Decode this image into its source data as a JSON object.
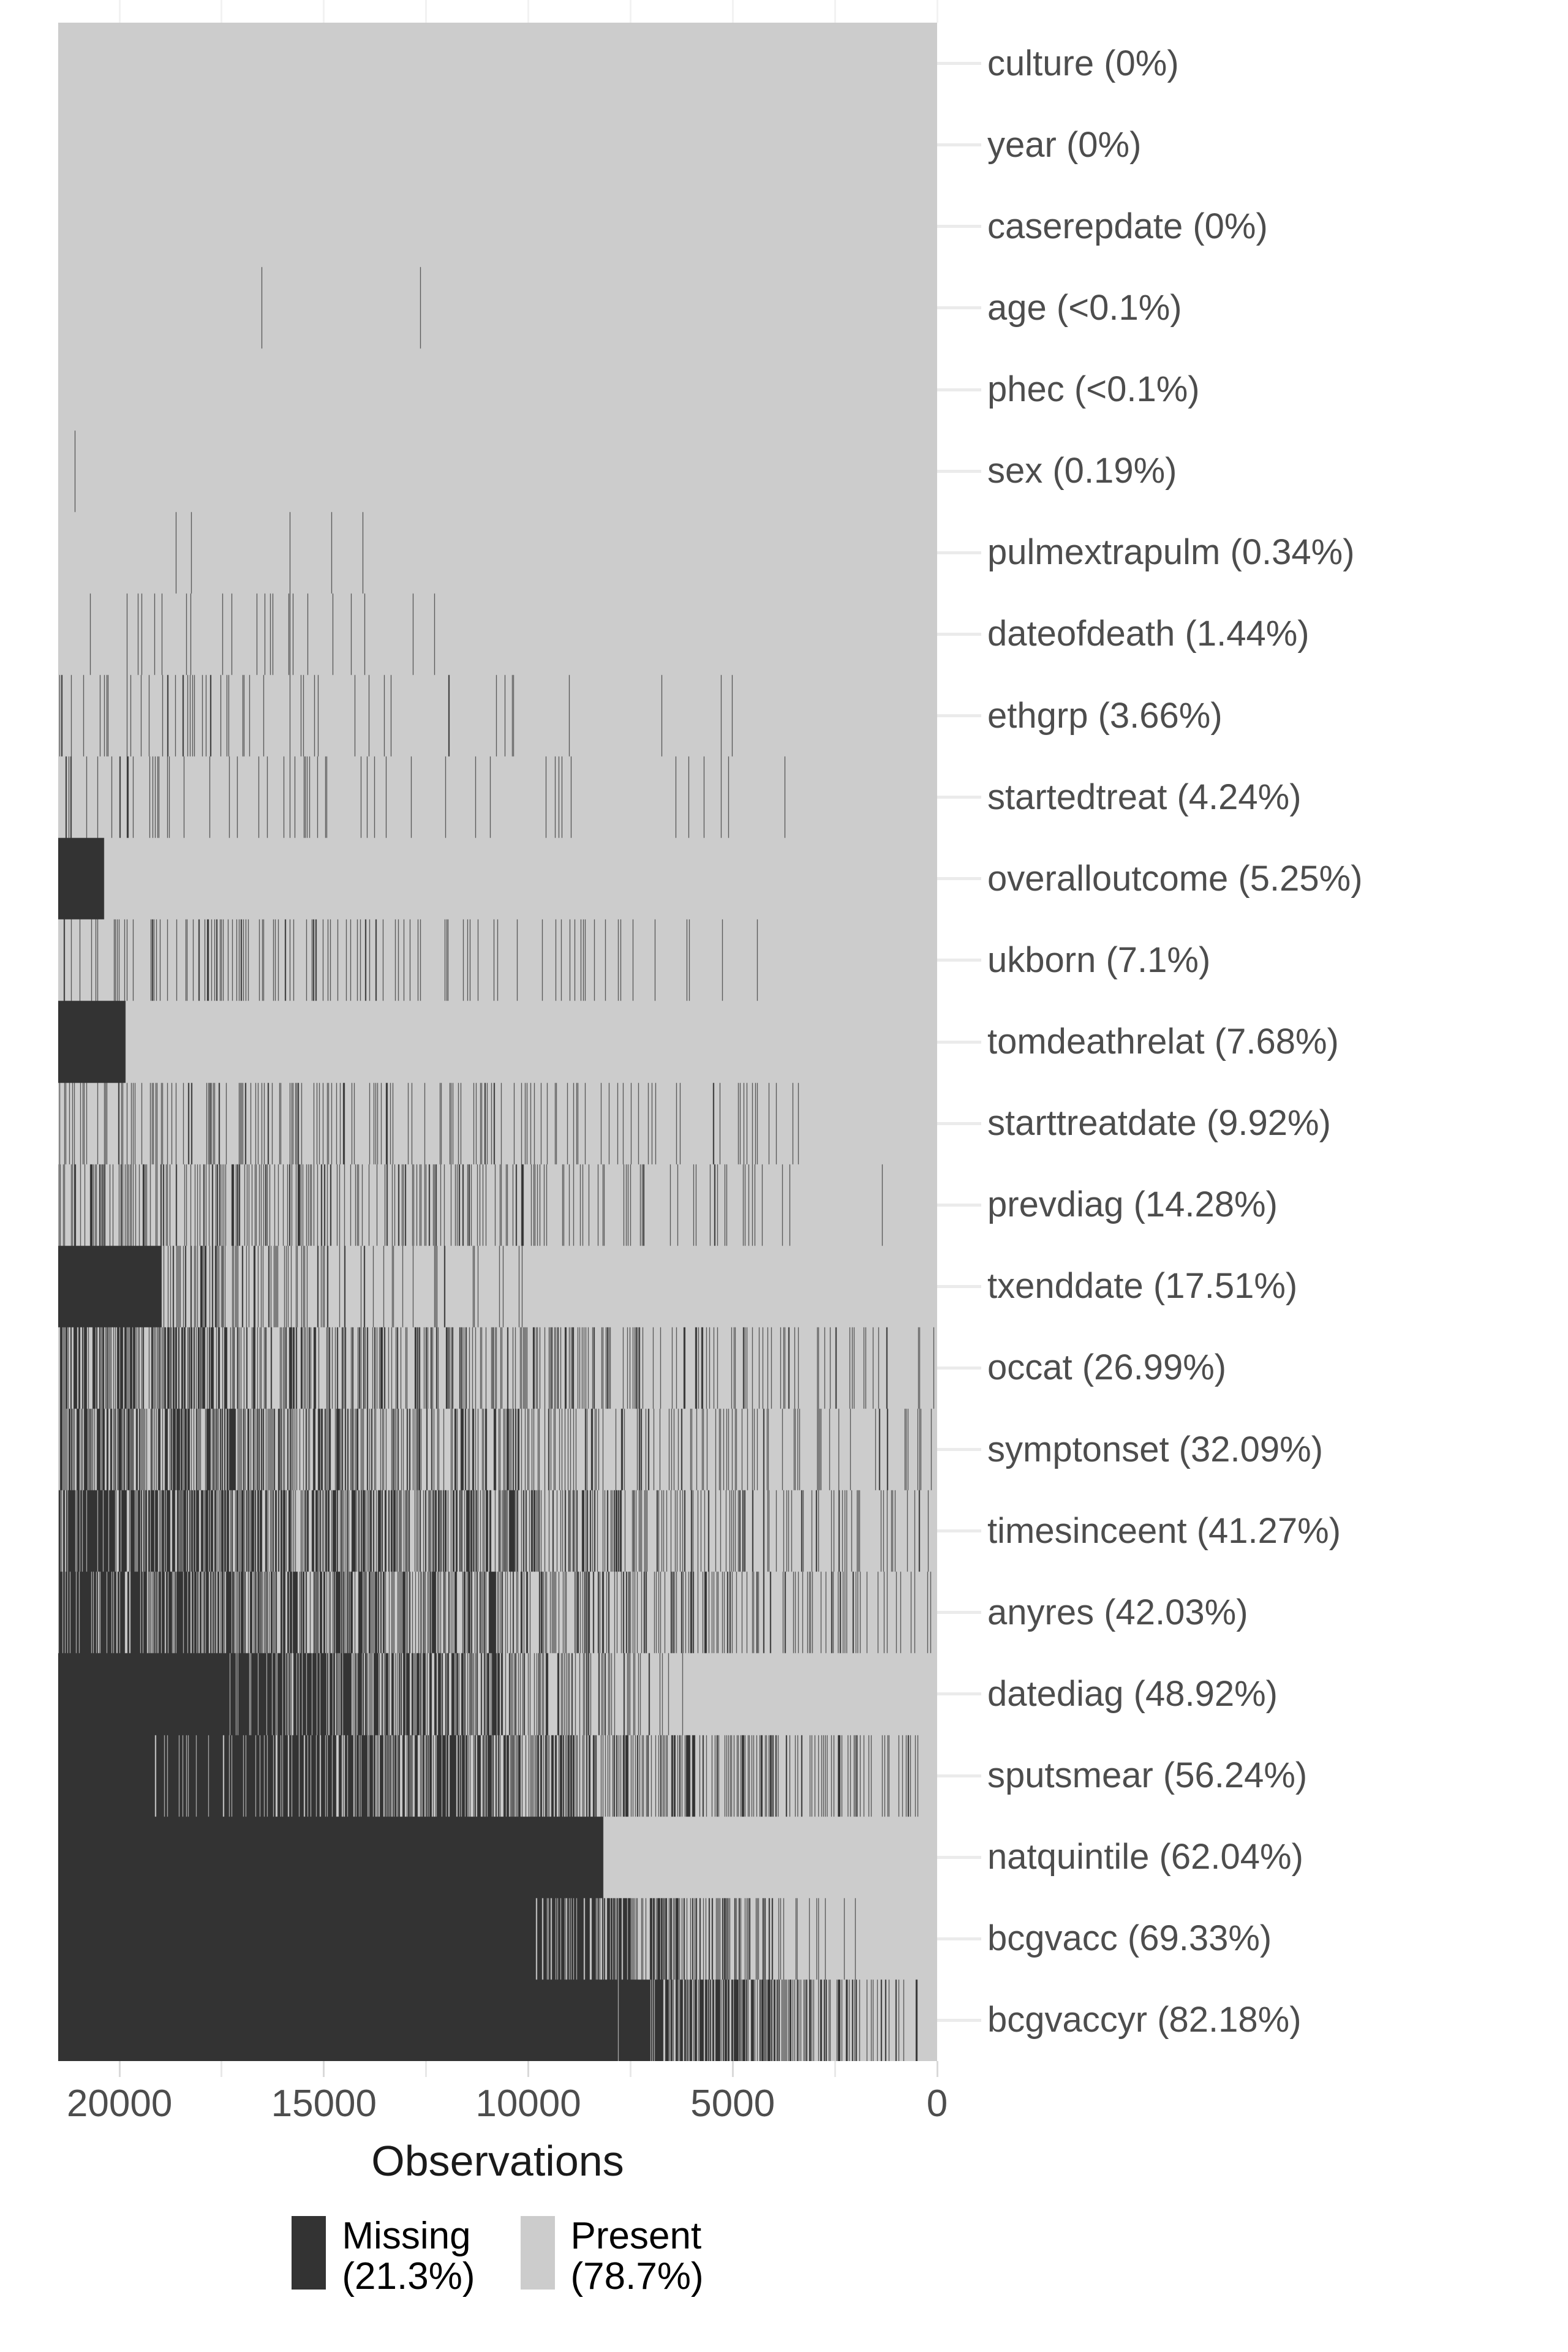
{
  "chart_data": {
    "type": "heatmap",
    "subtype": "missing-data-matrix",
    "title": "",
    "xlabel": "Observations",
    "ylabel": "",
    "x_axis_reversed": true,
    "xlim": [
      0,
      21500
    ],
    "x_ticks": [
      20000,
      15000,
      10000,
      5000,
      0
    ],
    "x_tick_labels": [
      "20000",
      "15000",
      "10000",
      "5000",
      "0"
    ],
    "x_minor_ticks": [
      17500,
      12500,
      7500,
      2500
    ],
    "total_observations": 21500,
    "grid": true,
    "legend_position": "bottom",
    "colors": {
      "missing": "#333333",
      "present": "#cccccc",
      "grid": "#ebebeb",
      "text": "#4d4d4d",
      "title_text": "#1a1a1a",
      "background": "#ffffff"
    },
    "legend": [
      {
        "key": "missing",
        "label_line1": "Missing",
        "label_line2": "(21.3%)",
        "swatch": "#333333"
      },
      {
        "key": "present",
        "label_line1": "Present",
        "label_line2": "(78.7%)",
        "swatch": "#cccccc"
      }
    ],
    "overall_missing_pct": 21.3,
    "overall_present_pct": 78.7,
    "categories": [
      "culture",
      "year",
      "caserepdate",
      "age",
      "phec",
      "sex",
      "pulmextrapulm",
      "dateofdeath",
      "ethgrp",
      "startedtreat",
      "overalloutcome",
      "ukborn",
      "tomdeathrelat",
      "starttreatdate",
      "prevdiag",
      "txenddate",
      "occat",
      "symptonset",
      "timesinceent",
      "anyres",
      "datediag",
      "sputsmear",
      "natquintile",
      "bcgvacc",
      "bcgvaccyr"
    ],
    "variables": [
      {
        "name": "culture",
        "pct_missing": 0.0,
        "pct_label": "0%",
        "label": "culture (0%)",
        "block": 0.0,
        "spread": 0.0
      },
      {
        "name": "year",
        "pct_missing": 0.0,
        "pct_label": "0%",
        "label": "year (0%)",
        "block": 0.0,
        "spread": 0.0
      },
      {
        "name": "caserepdate",
        "pct_missing": 0.0,
        "pct_label": "0%",
        "label": "caserepdate (0%)",
        "block": 0.0,
        "spread": 0.0
      },
      {
        "name": "age",
        "pct_missing": 0.05,
        "pct_label": "<0.1%",
        "label": "age (<0.1%)",
        "block": 0.0,
        "spread": 0.55
      },
      {
        "name": "phec",
        "pct_missing": 0.05,
        "pct_label": "<0.1%",
        "label": "phec (<0.1%)",
        "block": 0.0,
        "spread": 0.55
      },
      {
        "name": "sex",
        "pct_missing": 0.19,
        "pct_label": "0.19%",
        "label": "sex (0.19%)",
        "block": 0.0,
        "spread": 0.62
      },
      {
        "name": "pulmextrapulm",
        "pct_missing": 0.34,
        "pct_label": "0.34%",
        "label": "pulmextrapulm (0.34%)",
        "block": 0.0,
        "spread": 0.66
      },
      {
        "name": "dateofdeath",
        "pct_missing": 1.44,
        "pct_label": "1.44%",
        "label": "dateofdeath (1.44%)",
        "block": 0.0,
        "spread": 0.72
      },
      {
        "name": "ethgrp",
        "pct_missing": 3.66,
        "pct_label": "3.66%",
        "label": "ethgrp (3.66%)",
        "block": 0.0,
        "spread": 0.8
      },
      {
        "name": "startedtreat",
        "pct_missing": 4.24,
        "pct_label": "4.24%",
        "label": "startedtreat (4.24%)",
        "block": 0.0,
        "spread": 0.84
      },
      {
        "name": "overalloutcome",
        "pct_missing": 5.25,
        "pct_label": "5.25%",
        "label": "overalloutcome (5.25%)",
        "block": 0.0525,
        "spread": 0.0
      },
      {
        "name": "ukborn",
        "pct_missing": 7.1,
        "pct_label": "7.1%",
        "label": "ukborn (7.1%)",
        "block": 0.0,
        "spread": 0.88
      },
      {
        "name": "tomdeathrelat",
        "pct_missing": 7.68,
        "pct_label": "7.68%",
        "label": "tomdeathrelat (7.68%)",
        "block": 0.0768,
        "spread": 0.0
      },
      {
        "name": "starttreatdate",
        "pct_missing": 9.92,
        "pct_label": "9.92%",
        "label": "starttreatdate (9.92%)",
        "block": 0.0,
        "spread": 0.92
      },
      {
        "name": "prevdiag",
        "pct_missing": 14.28,
        "pct_label": "14.28%",
        "label": "prevdiag (14.28%)",
        "block": 0.0,
        "spread": 0.95
      },
      {
        "name": "txenddate",
        "pct_missing": 17.51,
        "pct_label": "17.51%",
        "label": "txenddate (17.51%)",
        "block": 0.118,
        "spread": 0.5
      },
      {
        "name": "occat",
        "pct_missing": 26.99,
        "pct_label": "26.99%",
        "label": "occat (26.99%)",
        "block": 0.0,
        "spread": 1.0
      },
      {
        "name": "symptonset",
        "pct_missing": 32.09,
        "pct_label": "32.09%",
        "label": "symptonset (32.09%)",
        "block": 0.0,
        "spread": 1.0
      },
      {
        "name": "timesinceent",
        "pct_missing": 41.27,
        "pct_label": "41.27%",
        "label": "timesinceent (41.27%)",
        "block": 0.0,
        "spread": 1.0
      },
      {
        "name": "anyres",
        "pct_missing": 42.03,
        "pct_label": "42.03%",
        "label": "anyres (42.03%)",
        "block": 0.0,
        "spread": 1.0
      },
      {
        "name": "datediag",
        "pct_missing": 48.92,
        "pct_label": "48.92%",
        "label": "datediag (48.92%)",
        "block": 0.0,
        "spread": 0.72
      },
      {
        "name": "sputsmear",
        "pct_missing": 56.24,
        "pct_label": "56.24%",
        "label": "sputsmear (56.24%)",
        "block": 0.0,
        "spread": 1.0
      },
      {
        "name": "natquintile",
        "pct_missing": 62.04,
        "pct_label": "62.04%",
        "label": "natquintile (62.04%)",
        "block": 0.6204,
        "spread": 0.0
      },
      {
        "name": "bcgvacc",
        "pct_missing": 69.33,
        "pct_label": "69.33%",
        "label": "bcgvacc (69.33%)",
        "block": 0.54,
        "spread": 0.82
      },
      {
        "name": "bcgvaccyr",
        "pct_missing": 82.18,
        "pct_label": "82.18%",
        "label": "bcgvaccyr (82.18%)",
        "block": 0.58,
        "spread": 0.95
      }
    ]
  },
  "axis": {
    "x_title": "Observations",
    "x_tick_labels": [
      "20000",
      "15000",
      "10000",
      "5000",
      "0"
    ]
  },
  "legend": {
    "missing_line1": "Missing",
    "missing_line2": "(21.3%)",
    "present_line1": "Present",
    "present_line2": "(78.7%)"
  }
}
